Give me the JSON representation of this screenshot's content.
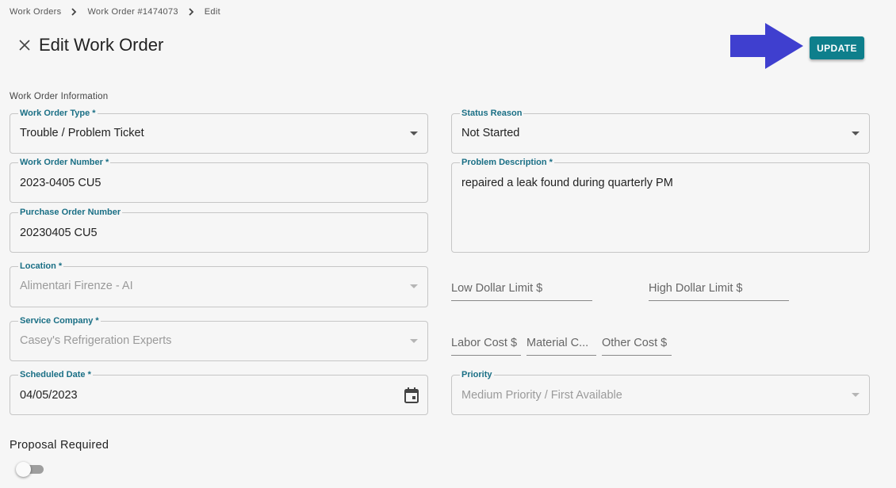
{
  "breadcrumb": {
    "items": [
      "Work Orders",
      "Work Order #1474073",
      "Edit"
    ]
  },
  "header": {
    "title": "Edit Work Order",
    "update_label": "UPDATE"
  },
  "colors": {
    "accent": "#0e7f8c",
    "label": "#1a6f85",
    "arrow": "#3f3fcf"
  },
  "section": {
    "title": "Work Order Information"
  },
  "fields": {
    "work_order_type": {
      "label": "Work Order Type",
      "required": "*",
      "value": "Trouble / Problem Ticket"
    },
    "status_reason": {
      "label": "Status Reason",
      "value": "Not Started"
    },
    "work_order_number": {
      "label": "Work Order Number",
      "required": "*",
      "value": "2023-0405 CU5"
    },
    "problem_description": {
      "label": "Problem Description",
      "required": "*",
      "value": "repaired a leak found during quarterly PM"
    },
    "purchase_order_number": {
      "label": "Purchase Order Number",
      "value": "20230405 CU5"
    },
    "location": {
      "label": "Location",
      "required": "*",
      "value": "Alimentari Firenze - AI"
    },
    "service_company": {
      "label": "Service Company",
      "required": "*",
      "value": "Casey's Refrigeration Experts"
    },
    "scheduled_date": {
      "label": "Scheduled Date",
      "required": "*",
      "value": "04/05/2023"
    },
    "priority": {
      "label": "Priority",
      "value": "Medium Priority / First Available"
    },
    "low_dollar_limit": {
      "label": "Low Dollar Limit $"
    },
    "high_dollar_limit": {
      "label": "High Dollar Limit $"
    },
    "labor_cost": {
      "label": "Labor Cost $"
    },
    "material_cost": {
      "label": "Material C..."
    },
    "other_cost": {
      "label": "Other Cost $"
    }
  },
  "proposal": {
    "label": "Proposal Required"
  },
  "icons": [
    "chevron-right-icon",
    "close-icon",
    "dropdown-caret-icon",
    "calendar-icon",
    "arrow-right-icon"
  ]
}
